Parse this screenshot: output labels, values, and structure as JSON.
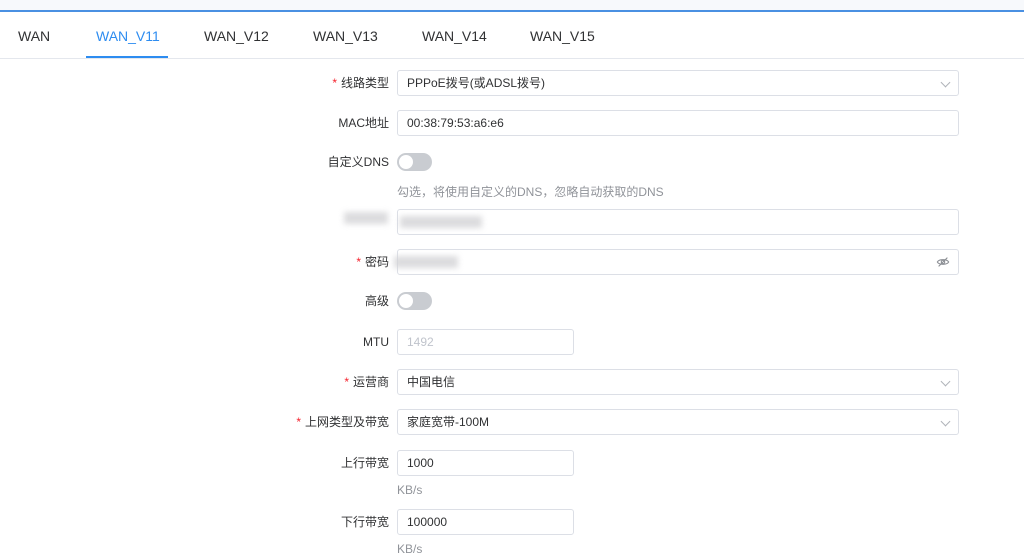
{
  "tabs": [
    {
      "label": "WAN"
    },
    {
      "label": "WAN_V11"
    },
    {
      "label": "WAN_V12"
    },
    {
      "label": "WAN_V13"
    },
    {
      "label": "WAN_V14"
    },
    {
      "label": "WAN_V15"
    }
  ],
  "active_tab": "WAN_V11",
  "form": {
    "line_type": {
      "label": "线路类型",
      "required": true,
      "value": "PPPoE拨号(或ADSL拨号)"
    },
    "mac": {
      "label": "MAC地址",
      "value": "00:38:79:53:a6:e6"
    },
    "custom_dns": {
      "label": "自定义DNS",
      "on": false,
      "hint": "勾选，将使用自定义的DNS，忽略自动获取的DNS"
    },
    "password": {
      "label": "密码",
      "required": true
    },
    "advanced": {
      "label": "高级",
      "on": false
    },
    "mtu": {
      "label": "MTU",
      "placeholder": "1492"
    },
    "isp": {
      "label": "运营商",
      "required": true,
      "value": "中国电信"
    },
    "access_type": {
      "label": "上网类型及带宽",
      "required": true,
      "value": "家庭宽带-100M"
    },
    "upload": {
      "label": "上行带宽",
      "value": "1000",
      "unit": "KB/s"
    },
    "download": {
      "label": "下行带宽",
      "value": "100000",
      "unit": "KB/s"
    }
  },
  "colors": {
    "accent": "#2d8cf0",
    "required": "#f5222d",
    "switch_off": "#c9ccd1"
  },
  "icons": [
    "chevron-down-icon",
    "eye-off-icon"
  ]
}
